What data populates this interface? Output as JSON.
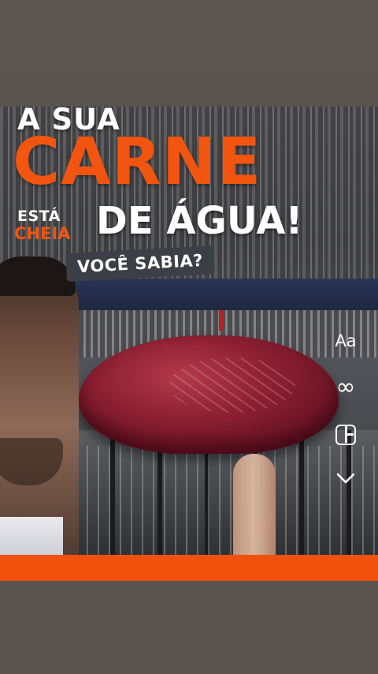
{
  "headline": {
    "line1": "A SUA",
    "line2": "CARNE",
    "small_top": "ESTÁ",
    "small_bottom": "CHEIA",
    "line3": "DE ÁGUA!",
    "question": "VOCÊ SABIA?"
  },
  "toolbar": {
    "text_tool_label": "Aa",
    "boomerang_icon": "infinity-icon",
    "layout_icon": "layout-icon",
    "more_icon": "chevron-down-icon"
  },
  "colors": {
    "accent": "#f25510",
    "bar": "#f0510c",
    "pill": "#3d3f46",
    "background": "#5a5450"
  }
}
